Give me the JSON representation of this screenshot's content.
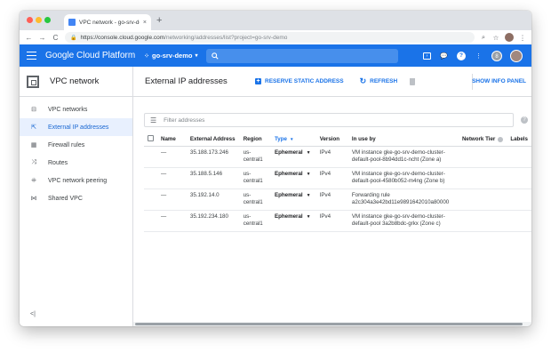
{
  "browser": {
    "tab_title": "VPC network - go-srv-demo",
    "tab_close": "×",
    "new_tab": "+",
    "url_host": "https://console.cloud.google.com",
    "url_path": "/networking/addresses/list?project=go-srv-demo",
    "nav": {
      "back": "←",
      "forward": "→",
      "reload": "C"
    }
  },
  "header": {
    "title": "Google Cloud Platform",
    "project": "go-srv-demo",
    "project_caret": "▾",
    "search_icon": "search-icon",
    "avatar_letter": "8",
    "icons": [
      "cloud-shell-icon",
      "support-icon",
      "help-icon",
      "more-vert-icon"
    ]
  },
  "sidebar": {
    "title": "VPC network",
    "items": [
      {
        "label": "VPC networks",
        "icon": "vpc-networks-icon",
        "active": false
      },
      {
        "label": "External IP addresses",
        "icon": "external-ip-icon",
        "active": true
      },
      {
        "label": "Firewall rules",
        "icon": "firewall-icon",
        "active": false
      },
      {
        "label": "Routes",
        "icon": "routes-icon",
        "active": false
      },
      {
        "label": "VPC network peering",
        "icon": "peering-icon",
        "active": false
      },
      {
        "label": "Shared VPC",
        "icon": "shared-vpc-icon",
        "active": false
      }
    ],
    "collapse": "<|"
  },
  "toolbar": {
    "title": "External IP addresses",
    "reserve_label": "RESERVE STATIC ADDRESS",
    "refresh_label": "REFRESH",
    "info_panel_label": "SHOW INFO PANEL"
  },
  "filter": {
    "placeholder": "Filter addresses"
  },
  "table": {
    "columns": {
      "name": "Name",
      "external_address": "External Address",
      "region": "Region",
      "type": "Type",
      "version": "Version",
      "in_use_by": "In use by",
      "network_tier": "Network Tier",
      "labels": "Labels"
    },
    "sort_indicator": "▾",
    "rows": [
      {
        "name": "—",
        "address": "35.188.173.246",
        "region": "us-central1",
        "type": "Ephemeral",
        "version": "IPv4",
        "in_use_by": "VM instance gke-go-srv-demo-cluster-default-pool-8b94dd1c-ncht (Zone a)"
      },
      {
        "name": "—",
        "address": "35.188.5.146",
        "region": "us-central1",
        "type": "Ephemeral",
        "version": "IPv4",
        "in_use_by": "VM instance gke-go-srv-demo-cluster-default-pool-4580b052-m4ng (Zone b)"
      },
      {
        "name": "—",
        "address": "35.192.14.0",
        "region": "us-central1",
        "type": "Ephemeral",
        "version": "IPv4",
        "in_use_by": "Forwarding rule a2c304a3e42bd11e9891642010a80000"
      },
      {
        "name": "—",
        "address": "35.192.234.180",
        "region": "us-central1",
        "type": "Ephemeral",
        "version": "IPv4",
        "in_use_by": "VM instance gke-go-srv-demo-cluster-default-pool 3a2b8bdc-grkx (Zone c)"
      }
    ]
  }
}
